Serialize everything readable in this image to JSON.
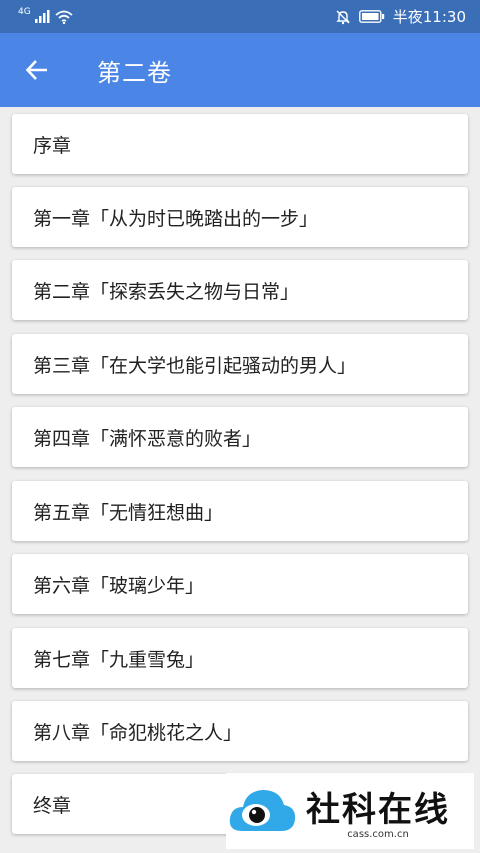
{
  "status_bar": {
    "network": "4G",
    "time": "半夜11:30"
  },
  "header": {
    "title": "第二卷"
  },
  "chapters": [
    {
      "label": "序章"
    },
    {
      "label": "第一章「从为时已晚踏出的一步」"
    },
    {
      "label": "第二章「探索丢失之物与日常」"
    },
    {
      "label": "第三章「在大学也能引起骚动的男人」"
    },
    {
      "label": "第四章「满怀恶意的败者」"
    },
    {
      "label": "第五章「无情狂想曲」"
    },
    {
      "label": "第六章「玻璃少年」"
    },
    {
      "label": "第七章「九重雪兔」"
    },
    {
      "label": "第八章「命犯桃花之人」"
    },
    {
      "label": "终章"
    }
  ],
  "watermark": {
    "name": "社科在线",
    "url": "cass.com.cn"
  },
  "colors": {
    "appbar": "#4b86e7",
    "statusbar": "#3a6fb8",
    "background": "#eeeeee",
    "card": "#ffffff"
  }
}
